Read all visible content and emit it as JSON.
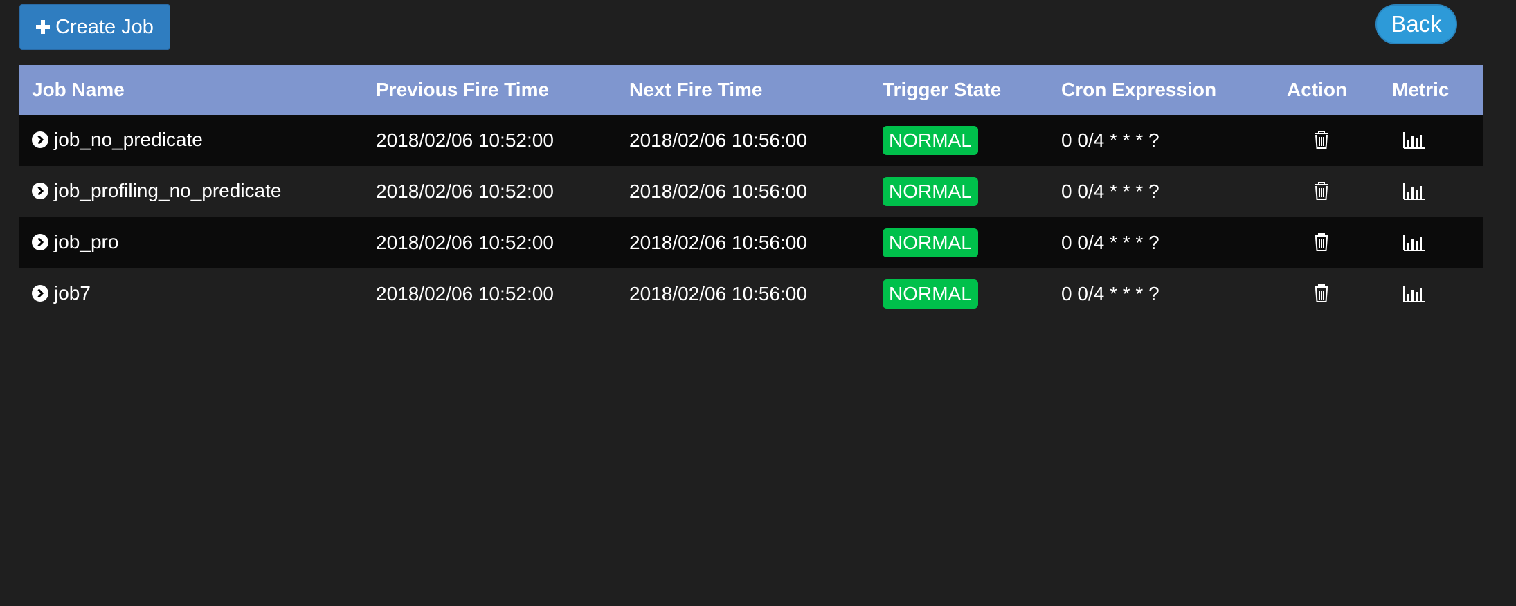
{
  "toolbar": {
    "create_label": "Create Job",
    "back_label": "Back"
  },
  "table": {
    "headers": [
      "Job Name",
      "Previous Fire Time",
      "Next Fire Time",
      "Trigger State",
      "Cron Expression",
      "Action",
      "Metric"
    ],
    "rows": [
      {
        "name": "job_no_predicate",
        "prev": "2018/02/06 10:52:00",
        "next": "2018/02/06 10:56:00",
        "state": "NORMAL",
        "cron": "0 0/4 * * * ?"
      },
      {
        "name": "job_profiling_no_predicate",
        "prev": "2018/02/06 10:52:00",
        "next": "2018/02/06 10:56:00",
        "state": "NORMAL",
        "cron": "0 0/4 * * * ?"
      },
      {
        "name": "job_pro",
        "prev": "2018/02/06 10:52:00",
        "next": "2018/02/06 10:56:00",
        "state": "NORMAL",
        "cron": "0 0/4 * * * ?"
      },
      {
        "name": "job7",
        "prev": "2018/02/06 10:52:00",
        "next": "2018/02/06 10:56:00",
        "state": "NORMAL",
        "cron": "0 0/4 * * * ?"
      }
    ]
  },
  "icons": {
    "create": "plus-icon",
    "row_expand": "chevron-circle-right-icon",
    "action": "trash-icon",
    "metric": "bar-chart-icon"
  },
  "colors": {
    "background": "#1f1f1f",
    "header": "#7f96cf",
    "create_button": "#2f7dc0",
    "back_button": "#2d9ad8",
    "state_normal": "#00c04b"
  }
}
